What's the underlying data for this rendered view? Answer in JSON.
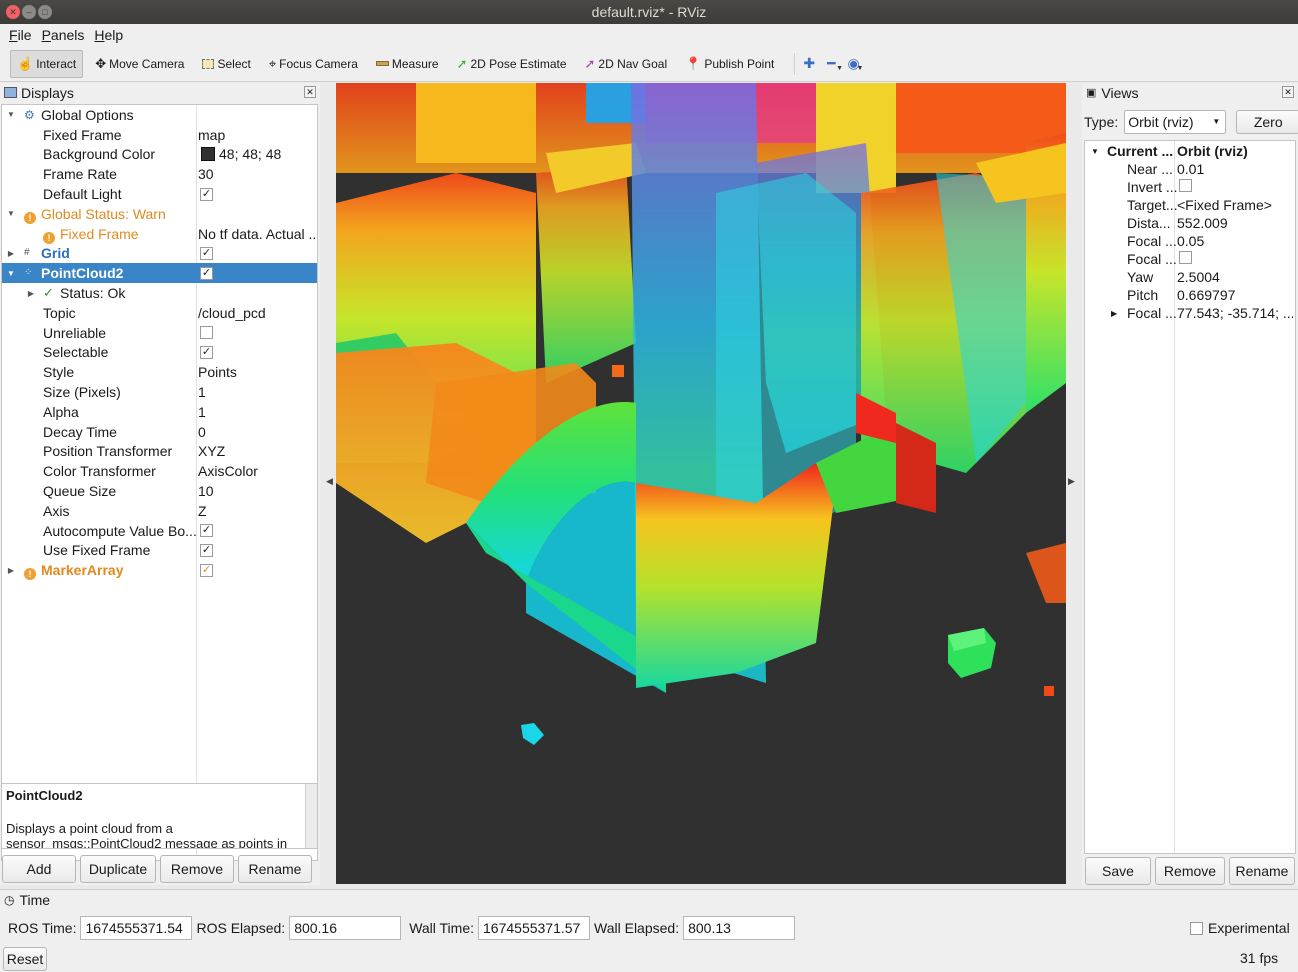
{
  "window": {
    "title": "default.rviz* - RViz"
  },
  "menu": [
    {
      "first": "F",
      "rest": "ile"
    },
    {
      "first": "P",
      "rest": "anels"
    },
    {
      "first": "H",
      "rest": "elp"
    }
  ],
  "toolbar": {
    "tools": [
      {
        "label": "Interact",
        "icon": "hand-icon"
      },
      {
        "label": "Move Camera",
        "icon": "move-icon"
      },
      {
        "label": "Select",
        "icon": "select-icon"
      },
      {
        "label": "Focus Camera",
        "icon": "focus-icon"
      },
      {
        "label": "Measure",
        "icon": "ruler-icon"
      },
      {
        "label": "2D Pose Estimate",
        "icon": "green-arrow-icon"
      },
      {
        "label": "2D Nav Goal",
        "icon": "purple-arrow-icon"
      },
      {
        "label": "Publish Point",
        "icon": "pin-icon"
      }
    ]
  },
  "displays": {
    "header": "Displays",
    "rows": [
      {
        "label": "Global Options",
        "value": ""
      },
      {
        "label": "Fixed Frame",
        "value": "map"
      },
      {
        "label": "Background Color",
        "value": "48; 48; 48"
      },
      {
        "label": "Frame Rate",
        "value": "30"
      },
      {
        "label": "Default Light",
        "value": ""
      },
      {
        "label": "Global Status: Warn",
        "value": ""
      },
      {
        "label": "Fixed Frame",
        "value": "No tf data.  Actual ..."
      },
      {
        "label": "Grid",
        "value": ""
      },
      {
        "label": "PointCloud2",
        "value": ""
      },
      {
        "label": "Status: Ok",
        "value": ""
      },
      {
        "label": "Topic",
        "value": "/cloud_pcd"
      },
      {
        "label": "Unreliable",
        "value": ""
      },
      {
        "label": "Selectable",
        "value": ""
      },
      {
        "label": "Style",
        "value": "Points"
      },
      {
        "label": "Size (Pixels)",
        "value": "1"
      },
      {
        "label": "Alpha",
        "value": "1"
      },
      {
        "label": "Decay Time",
        "value": "0"
      },
      {
        "label": "Position Transformer",
        "value": "XYZ"
      },
      {
        "label": "Color Transformer",
        "value": "AxisColor"
      },
      {
        "label": "Queue Size",
        "value": "10"
      },
      {
        "label": "Axis",
        "value": "Z"
      },
      {
        "label": "Autocompute Value Bo...",
        "value": ""
      },
      {
        "label": "Use Fixed Frame",
        "value": ""
      },
      {
        "label": "MarkerArray",
        "value": ""
      }
    ],
    "description_title": "PointCloud2",
    "description_text": "Displays a point cloud from a sensor_msgs::PointCloud2 message as points in",
    "buttons": [
      "Add",
      "Duplicate",
      "Remove",
      "Rename"
    ]
  },
  "views": {
    "header": "Views",
    "type_label": "Type:",
    "type_value": "Orbit (rviz)",
    "zero_label": "Zero",
    "rows": [
      {
        "label": "Current ...",
        "value": "Orbit (rviz)"
      },
      {
        "label": "Near ...",
        "value": "0.01"
      },
      {
        "label": "Invert ...",
        "value": ""
      },
      {
        "label": "Target...",
        "value": "<Fixed Frame>"
      },
      {
        "label": "Dista...",
        "value": "552.009"
      },
      {
        "label": "Focal ...",
        "value": "0.05"
      },
      {
        "label": "Focal ...",
        "value": ""
      },
      {
        "label": "Yaw",
        "value": "2.5004"
      },
      {
        "label": "Pitch",
        "value": "0.669797"
      },
      {
        "label": "Focal ...",
        "value": "77.543; -35.714; ..."
      }
    ],
    "buttons": [
      "Save",
      "Remove",
      "Rename"
    ]
  },
  "time": {
    "header": "Time",
    "ros_time_label": "ROS Time:",
    "ros_time": "1674555371.54",
    "ros_elapsed_label": "ROS Elapsed:",
    "ros_elapsed": "800.16",
    "wall_time_label": "Wall Time:",
    "wall_time": "1674555371.57",
    "wall_elapsed_label": "Wall Elapsed:",
    "wall_elapsed": "800.13",
    "experimental_label": "Experimental",
    "reset_label": "Reset",
    "fps": "31 fps"
  },
  "colors": {
    "accent": "#3a85c7",
    "warn": "#e08a1e",
    "viewport_bg": "#303030"
  }
}
